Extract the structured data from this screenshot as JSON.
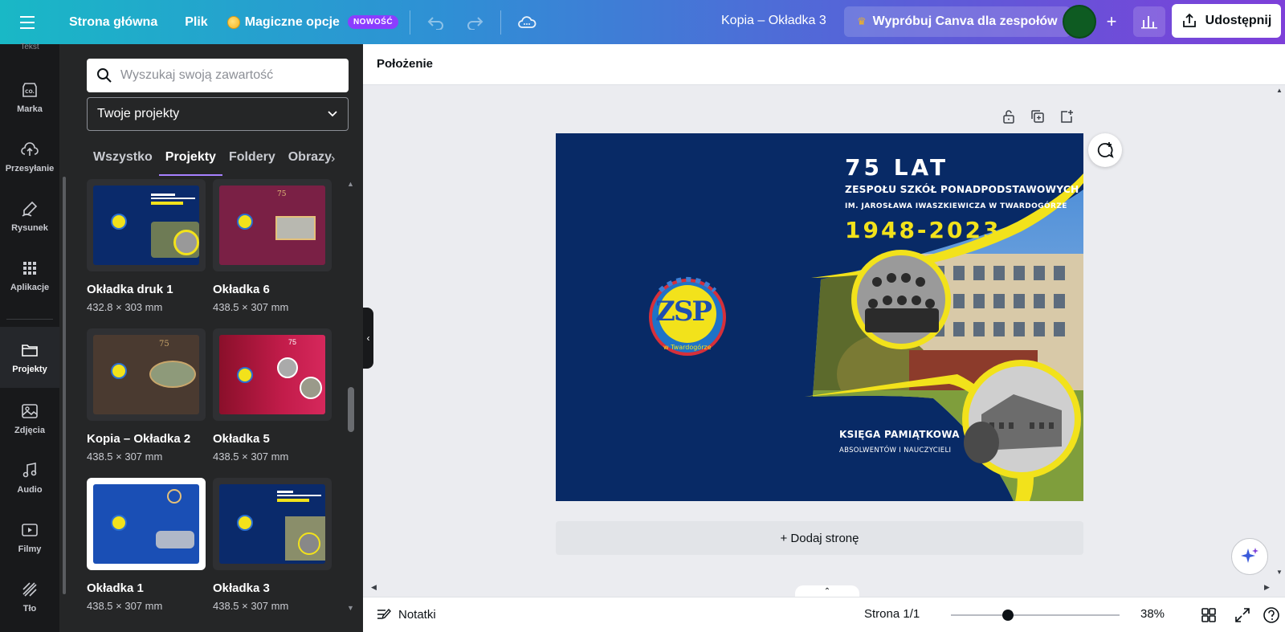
{
  "topbar": {
    "home_label": "Strona główna",
    "file_label": "Plik",
    "magic_label": "Magiczne opcje",
    "new_badge": "NOWOŚĆ",
    "doc_title": "Kopia – Okładka 3",
    "teams_label": "Wypróbuj Canva dla zespołów",
    "share_label": "Udostępnij"
  },
  "leftnav": {
    "items": [
      {
        "label": "Marka",
        "icon": "brand-icon"
      },
      {
        "label": "Przesyłanie",
        "icon": "upload-icon"
      },
      {
        "label": "Rysunek",
        "icon": "draw-icon"
      },
      {
        "label": "Aplikacje",
        "icon": "apps-icon"
      },
      {
        "label": "Projekty",
        "icon": "folder-icon",
        "active": true
      },
      {
        "label": "Zdjęcia",
        "icon": "photos-icon"
      },
      {
        "label": "Audio",
        "icon": "audio-icon"
      },
      {
        "label": "Filmy",
        "icon": "video-icon"
      },
      {
        "label": "Tło",
        "icon": "background-icon"
      }
    ],
    "partial_top_label": "Tekst"
  },
  "panel": {
    "search_placeholder": "Wyszukaj swoją zawartość",
    "select_value": "Twoje projekty",
    "tabs": [
      "Wszystko",
      "Projekty",
      "Foldery",
      "Obrazy"
    ],
    "active_tab": "Projekty",
    "cards": [
      {
        "name": "Okładka druk 1",
        "size": "432.8 × 303 mm",
        "theme": "navy"
      },
      {
        "name": "Okładka 6",
        "size": "438.5 × 307 mm",
        "theme": "maroon"
      },
      {
        "name": "Kopia – Okładka 2",
        "size": "438.5 × 307 mm",
        "theme": "brown"
      },
      {
        "name": "Okładka 5",
        "size": "438.5 × 307 mm",
        "theme": "red"
      },
      {
        "name": "Okładka 1",
        "size": "438.5 × 307 mm",
        "theme": "blue"
      },
      {
        "name": "Okładka 3",
        "size": "438.5 × 307 mm",
        "theme": "navy"
      }
    ]
  },
  "subbar": {
    "position_label": "Położenie"
  },
  "design": {
    "years_title": "75 LAT",
    "school_line1": "ZESPOŁU SZKÓŁ PONADPODSTAWOWYCH",
    "school_line2": "IM. JAROSŁAWA IWASZKIEWICZA W TWARDOGÓRZE",
    "date_range": "1948-2023",
    "book_title": "KSIĘGA PAMIĄTKOWA",
    "book_subtitle": "ABSOLWENTÓW I NAUCZYCIELI",
    "logo_text": "ZSP",
    "logo_ring_text": "w Twardogórze",
    "colors": {
      "navy": "#082a66",
      "yellow": "#f2e21b"
    }
  },
  "canvas": {
    "add_page_label": "+ Dodaj stronę"
  },
  "bottombar": {
    "notes_label": "Notatki",
    "page_info": "Strona 1/1",
    "zoom_value": "38%",
    "zoom_level": 0.38
  }
}
